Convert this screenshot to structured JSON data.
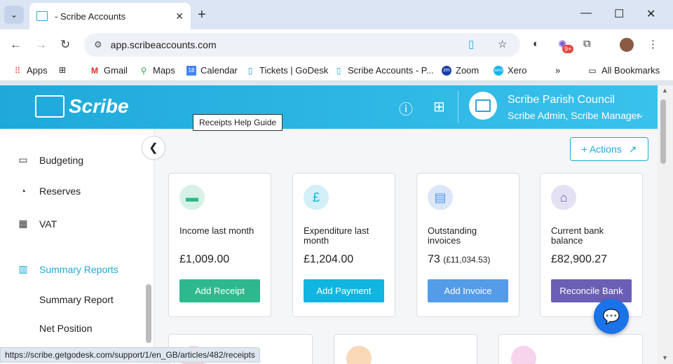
{
  "browser": {
    "tab_title": "- Scribe Accounts",
    "tab_close": "✕",
    "new_tab": "+",
    "url": "app.scribeaccounts.com",
    "bookmarks": [
      {
        "label": "Apps",
        "icon": "apps-grid-icon"
      },
      {
        "label": "",
        "icon": "grid-icon"
      },
      {
        "label": "Gmail",
        "icon": "gmail-icon"
      },
      {
        "label": "Maps",
        "icon": "maps-icon"
      },
      {
        "label": "Calendar",
        "icon": "calendar-icon"
      },
      {
        "label": "Tickets | GoDesk",
        "icon": "scribe-icon"
      },
      {
        "label": "Scribe Accounts - P...",
        "icon": "scribe-icon"
      },
      {
        "label": "Zoom",
        "icon": "zoom-icon"
      },
      {
        "label": "Xero",
        "icon": "xero-icon"
      },
      {
        "label": "All Bookmarks",
        "icon": "folder-icon"
      }
    ],
    "ext_badge": "9+",
    "status_url": "https://scribe.getgodesk.com/support/1/en_GB/articles/482/receipts"
  },
  "app": {
    "logo_text": "Scribe",
    "org_name": "Scribe Parish Council",
    "org_role": "Scribe Admin, Scribe Manager",
    "sidebar": {
      "items": [
        {
          "label": "Budgeting",
          "icon": "budget-icon"
        },
        {
          "label": "Reserves",
          "icon": "reserves-icon"
        },
        {
          "label": "VAT",
          "icon": "vat-icon"
        },
        {
          "label": "Summary Reports",
          "icon": "chart-icon",
          "active": true
        }
      ],
      "subitems": [
        "Summary Report",
        "Net Position"
      ]
    },
    "actions_label": "+ Actions",
    "tooltip": "Receipts Help Guide",
    "cards": [
      {
        "label": "Income last month",
        "value": "£1,009.00",
        "value_sub": "",
        "button": "Add Receipt",
        "color": "#2db98d",
        "icon_bg": "#d7f1e6"
      },
      {
        "label": "Expenditure last month",
        "value": "£1,204.00",
        "value_sub": "",
        "button": "Add Payment",
        "color": "#10b5e0",
        "icon_bg": "#d3eff8",
        "icon_glyph": "£"
      },
      {
        "label": "Outstanding invoices",
        "value": "73",
        "value_sub": "(£11,034.53)",
        "button": "Add Invoice",
        "color": "#549be8",
        "icon_bg": "#dbe7f8"
      },
      {
        "label": "Current bank balance",
        "value": "£82,900.27",
        "value_sub": "",
        "button": "Reconcile Bank",
        "color": "#6a5fb5",
        "icon_bg": "#e4e1f4"
      }
    ]
  }
}
